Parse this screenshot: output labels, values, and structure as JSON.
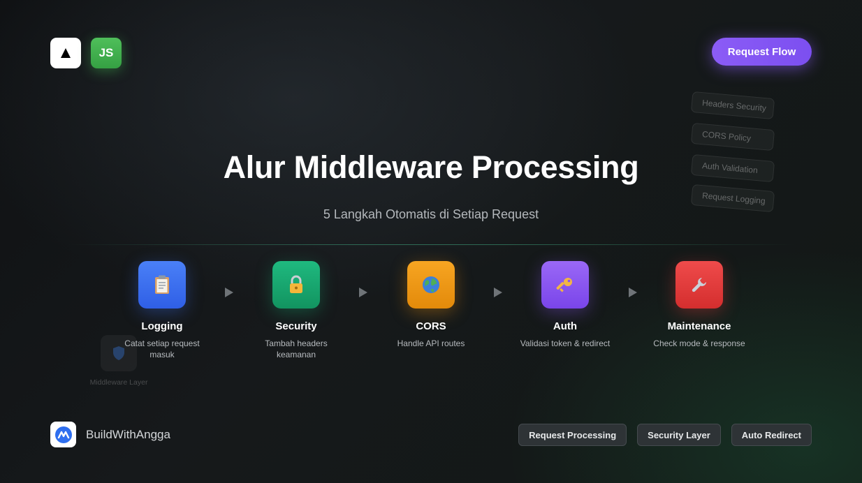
{
  "header": {
    "logos": [
      {
        "icon": "nextjs-triangle-icon"
      },
      {
        "icon": "js-icon",
        "label": "JS"
      }
    ],
    "cta_label": "Request Flow"
  },
  "floating_tags": [
    "Headers Security",
    "CORS Policy",
    "Auth Validation",
    "Request Logging"
  ],
  "title": "Alur Middleware Processing",
  "subtitle": "5 Langkah Otomatis di Setiap Request",
  "ghost_layer": {
    "icon": "shield-icon",
    "label": "Middleware Layer"
  },
  "steps": [
    {
      "name": "Logging",
      "desc": "Catat setiap request masuk",
      "icon": "clipboard-icon",
      "color": "#3b6ff2"
    },
    {
      "name": "Security",
      "desc": "Tambah headers keamanan",
      "icon": "lock-icon",
      "color": "#16a570"
    },
    {
      "name": "CORS",
      "desc": "Handle API routes",
      "icon": "globe-icon",
      "color": "#f0950f"
    },
    {
      "name": "Auth",
      "desc": "Validasi token & redirect",
      "icon": "key-icon",
      "color": "#8a55f0"
    },
    {
      "name": "Maintenance",
      "desc": "Check mode & response",
      "icon": "wrench-icon",
      "color": "#e43a3a"
    }
  ],
  "footer": {
    "brand": "BuildWithAngga",
    "tags": [
      "Request Processing",
      "Security Layer",
      "Auto Redirect"
    ]
  },
  "colors": {
    "accent": "#8b5cf6",
    "js_green": "#45b552",
    "divider": "#48c896"
  }
}
